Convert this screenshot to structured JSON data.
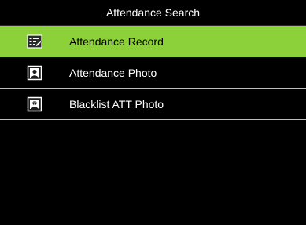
{
  "header": {
    "title": "Attendance Search"
  },
  "menu": {
    "items": [
      {
        "label": "Attendance Record",
        "icon": "record-edit-icon",
        "selected": true
      },
      {
        "label": "Attendance Photo",
        "icon": "photo-icon",
        "selected": false
      },
      {
        "label": "Blacklist ATT Photo",
        "icon": "blacklist-photo-icon",
        "selected": false
      }
    ]
  },
  "colors": {
    "background": "#000000",
    "selected_highlight": "#8cd13a",
    "divider": "#bdbdbd",
    "text": "#ffffff",
    "selected_text": "#000000"
  }
}
